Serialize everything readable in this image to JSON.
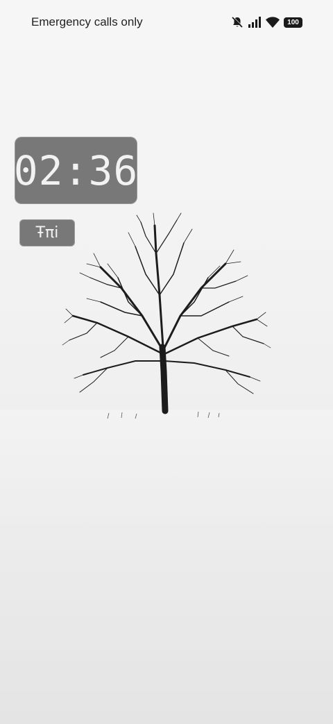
{
  "status_bar": {
    "carrier_text": "Emergency calls only",
    "battery_level": "100",
    "icons": [
      "bell-muted-icon",
      "signal-icon",
      "wifi-icon",
      "battery-icon"
    ]
  },
  "clock_widget": {
    "time": "02:36"
  },
  "day_widget": {
    "day": "Ŧπi"
  },
  "wallpaper": {
    "subject": "tree-silhouette"
  },
  "colors": {
    "widget_bg": "#787878",
    "widget_text": "#f2f2f2",
    "background": "#f2f2f2"
  }
}
